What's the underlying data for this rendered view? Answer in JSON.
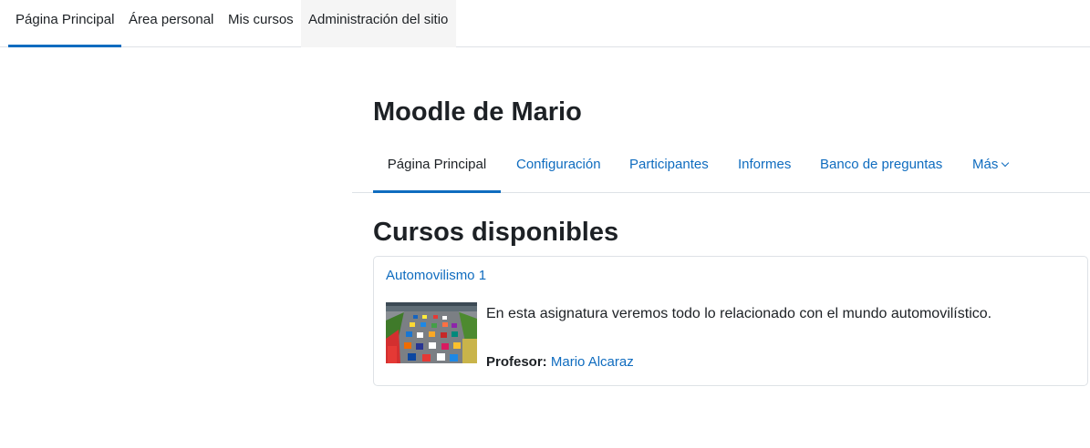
{
  "topnav": {
    "items": [
      {
        "label": "Página Principal"
      },
      {
        "label": "Área personal"
      },
      {
        "label": "Mis cursos"
      },
      {
        "label": "Administración del sitio"
      }
    ]
  },
  "page": {
    "title": "Moodle de Mario"
  },
  "secnav": {
    "tabs": [
      {
        "label": "Página Principal"
      },
      {
        "label": "Configuración"
      },
      {
        "label": "Participantes"
      },
      {
        "label": "Informes"
      },
      {
        "label": "Banco de preguntas"
      },
      {
        "label": "Más"
      }
    ]
  },
  "courses": {
    "heading": "Cursos disponibles",
    "items": [
      {
        "name": "Automovilismo 1",
        "summary": "En esta asignatura veremos todo lo relacionado con el mundo automovilístico.",
        "teacher_label": "Profesor:",
        "teacher_name": "Mario Alcaraz"
      }
    ]
  },
  "colors": {
    "link": "#0f6cbf",
    "text": "#1d2125",
    "border": "#dee2e6"
  }
}
